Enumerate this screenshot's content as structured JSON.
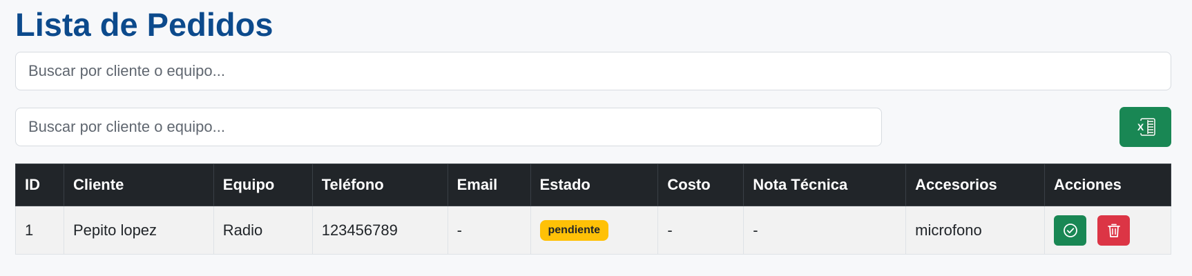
{
  "header": {
    "title": "Lista de Pedidos"
  },
  "search": {
    "top_placeholder": "Buscar por cliente o equipo...",
    "bottom_placeholder": "Buscar por cliente o equipo...",
    "top_value": "",
    "bottom_value": ""
  },
  "toolbar": {
    "export_icon": "excel-icon",
    "export_icon_text": "X",
    "export_color": "#198754"
  },
  "table": {
    "columns": [
      "ID",
      "Cliente",
      "Equipo",
      "Teléfono",
      "Email",
      "Estado",
      "Costo",
      "Nota Técnica",
      "Accesorios",
      "Acciones"
    ],
    "rows": [
      {
        "id": "1",
        "cliente": "Pepito lopez",
        "equipo": "Radio",
        "telefono": "123456789",
        "email": "-",
        "estado": "pendiente",
        "costo": "-",
        "nota": "-",
        "accesorios": "microfono",
        "acciones": [
          {
            "icon": "check-circle-icon",
            "color": "#198754"
          },
          {
            "icon": "trash-icon",
            "color": "#dc3545"
          }
        ]
      }
    ]
  },
  "colors": {
    "title": "#0c4a8c",
    "table_header": "#212529",
    "badge_pending": "#ffc107",
    "delete": "#dc3545",
    "success": "#198754"
  }
}
